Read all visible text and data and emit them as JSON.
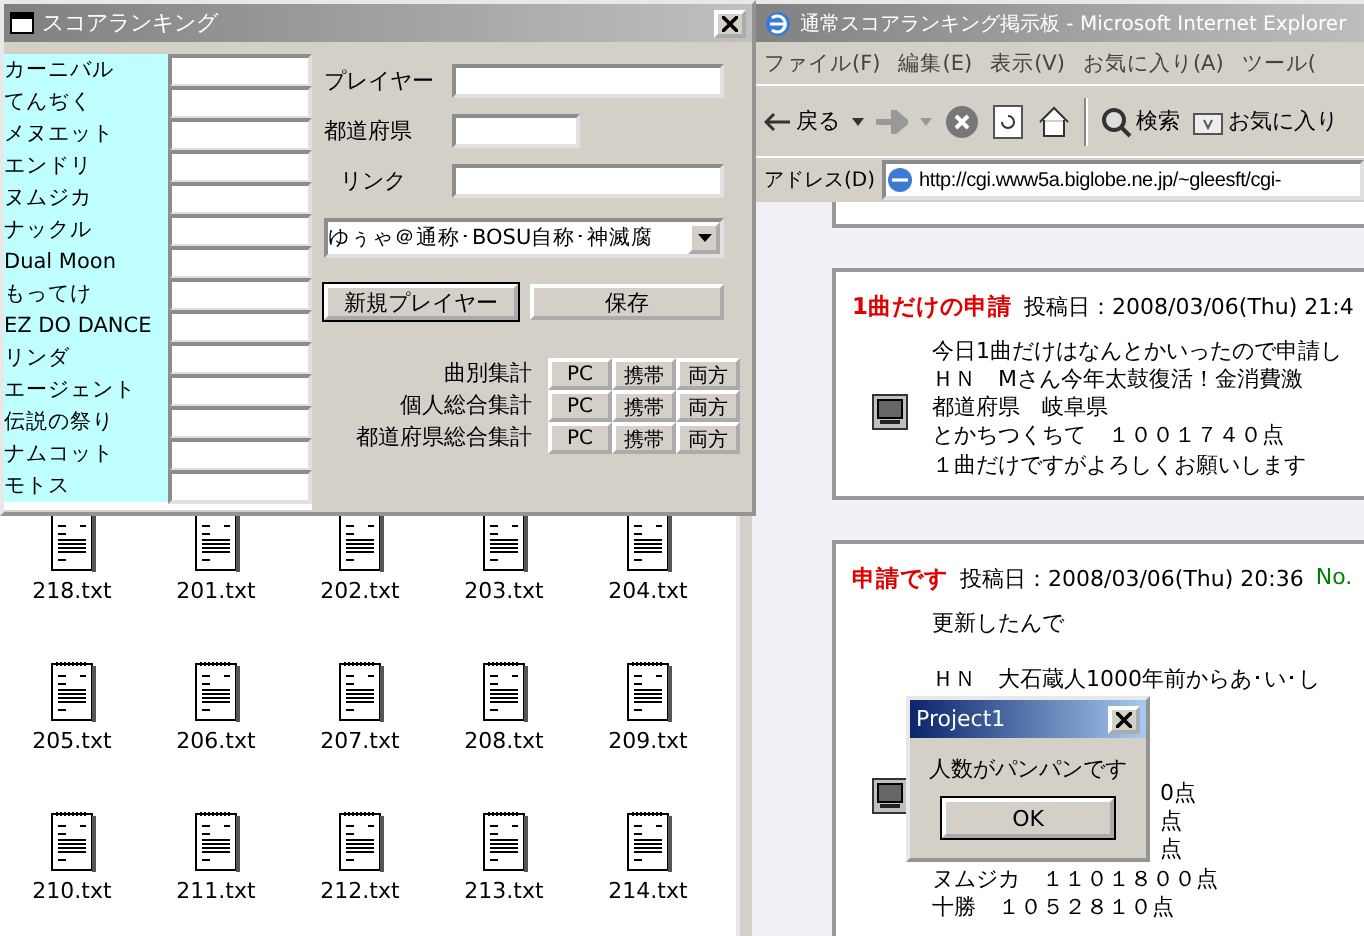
{
  "score_window": {
    "title": "スコアランキング",
    "songs": [
      "カーニバル",
      "てんぢく",
      "メヌエット",
      "エンドリ",
      "ヌムジカ",
      "ナックル",
      "Dual Moon",
      "もってけ",
      "EZ DO DANCE",
      "リンダ",
      "エージェント",
      "伝説の祭り",
      "ナムコット",
      "モトス"
    ],
    "fields": [
      {
        "label": "プレイヤー",
        "kind": "wide"
      },
      {
        "label": "都道府県",
        "kind": "short"
      },
      {
        "label": "リンク",
        "kind": "wide"
      }
    ],
    "player_select": "ゆぅゃ＠通称･BOSU自称･神滅腐",
    "buttons": [
      {
        "label": "新規プレイヤー",
        "focused": true
      },
      {
        "label": "保存",
        "focused": false
      }
    ],
    "aggregates": [
      {
        "label": "曲別集計",
        "buttons": [
          "PC",
          "携帯",
          "両方"
        ]
      },
      {
        "label": "個人総合集計",
        "buttons": [
          "PC",
          "携帯",
          "両方"
        ]
      },
      {
        "label": "都道府県総合集計",
        "buttons": [
          "PC",
          "携帯",
          "両方"
        ]
      }
    ]
  },
  "files": [
    "218.txt",
    "201.txt",
    "202.txt",
    "203.txt",
    "204.txt",
    "205.txt",
    "206.txt",
    "207.txt",
    "208.txt",
    "209.txt",
    "210.txt",
    "211.txt",
    "212.txt",
    "213.txt",
    "214.txt"
  ],
  "browser": {
    "title": "通常スコアランキング掲示板 - Microsoft Internet Explorer",
    "menu": [
      "ファイル(F)",
      "編集(E)",
      "表示(V)",
      "お気に入り(A)",
      "ツール("
    ],
    "toolbar": {
      "back": "戻る",
      "search": "検索",
      "favorites": "お気に入り"
    },
    "address_label": "アドレス(D)",
    "url": "http://cgi.www5a.biglobe.ne.jp/~gleesft/cgi-",
    "posts": [
      {
        "title": "1曲だけの申請",
        "date": "投稿日：2008/03/06(Thu) 21:4",
        "lines": [
          {
            "kind": "text",
            "text": "今日1曲だけはなんとかいったので申請し"
          },
          {
            "kind": "text",
            "text": "ＨＮ　Mさん今年太鼓復活！金消費激"
          },
          {
            "kind": "text",
            "text": "都道府県　岐阜県"
          },
          {
            "kind": "text",
            "text": "とかちつくちて　１００１７４０点"
          },
          {
            "kind": "text",
            "text": "１曲だけですがよろしくお願いします"
          }
        ]
      },
      {
        "title": "申請です",
        "date": "投稿日：2008/03/06(Thu) 20:36",
        "number": "No.",
        "lines": [
          {
            "kind": "text",
            "text": "更新したんで"
          },
          {
            "kind": "gap"
          },
          {
            "kind": "text",
            "text": "ＨＮ　大石蔵人1000年前からあ･い･し"
          },
          {
            "kind": "gap"
          },
          {
            "kind": "gap"
          },
          {
            "kind": "gap"
          },
          {
            "kind": "fragment",
            "text": "0点"
          },
          {
            "kind": "fragment",
            "text": "点"
          },
          {
            "kind": "fragment",
            "text": "点"
          },
          {
            "kind": "text",
            "text": "ヌムジカ　１１０１８００点"
          },
          {
            "kind": "text",
            "text": "十勝　１０５２８１０点"
          }
        ]
      }
    ]
  },
  "dialog": {
    "title": "Project1",
    "message": "人数がパンパンです",
    "ok": "OK"
  }
}
